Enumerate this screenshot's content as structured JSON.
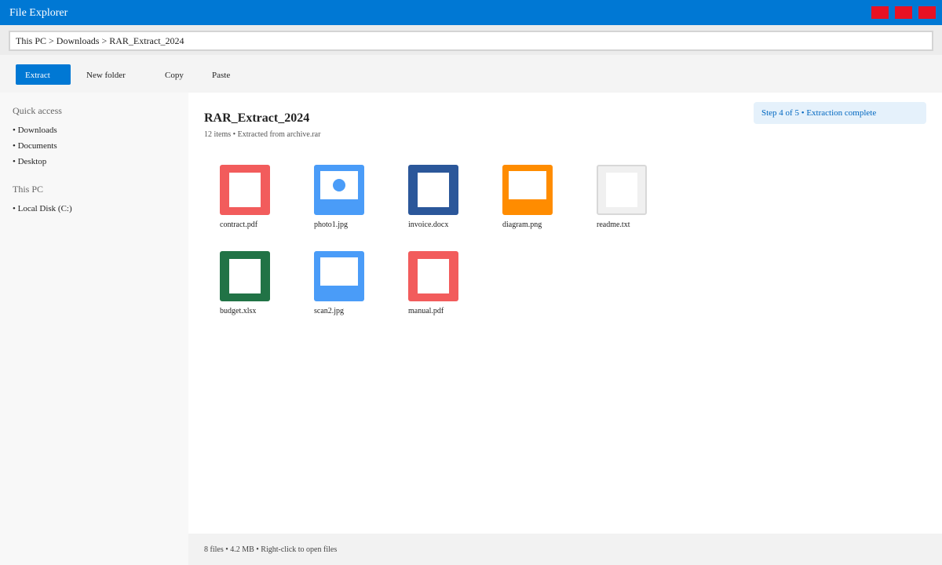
{
  "window": {
    "title": "File Explorer"
  },
  "address": {
    "path": "This PC > Downloads > RAR_Extract_2024"
  },
  "toolbar": {
    "extract_label": "Extract",
    "new_folder_label": "New folder",
    "copy_label": "Copy",
    "paste_label": "Paste"
  },
  "sidebar": {
    "quick_access_heading": "Quick access",
    "quick_access": [
      "• Downloads",
      "• Documents",
      "• Desktop"
    ],
    "this_pc_heading": "This PC",
    "this_pc": [
      "• Local Disk (C:)"
    ]
  },
  "main": {
    "folder_title": "RAR_Extract_2024",
    "folder_subtitle": "12 items • Extracted from archive.rar",
    "step_banner": "Step 4 of 5 • Extraction complete",
    "files": [
      {
        "name": "contract.pdf",
        "icon": "pdf-icon",
        "color": "#f25c5c"
      },
      {
        "name": "photo1.jpg",
        "icon": "image-icon",
        "color": "#4a9cf8"
      },
      {
        "name": "invoice.docx",
        "icon": "word-icon",
        "color": "#2b579a"
      },
      {
        "name": "diagram.png",
        "icon": "png-icon",
        "color": "#ff8c00"
      },
      {
        "name": "readme.txt",
        "icon": "text-icon",
        "color": "#f0f0f0"
      },
      {
        "name": "budget.xlsx",
        "icon": "excel-icon",
        "color": "#217346"
      },
      {
        "name": "scan2.jpg",
        "icon": "image-icon",
        "color": "#4a9cf8"
      },
      {
        "name": "manual.pdf",
        "icon": "pdf-icon",
        "color": "#f25c5c"
      }
    ]
  },
  "status": {
    "text": "8 files • 4.2 MB • Right-click to open files"
  },
  "colors": {
    "accent": "#0078d4",
    "window_control": "#e81123",
    "banner_bg": "#e5f1fb",
    "banner_text": "#0067c0"
  }
}
